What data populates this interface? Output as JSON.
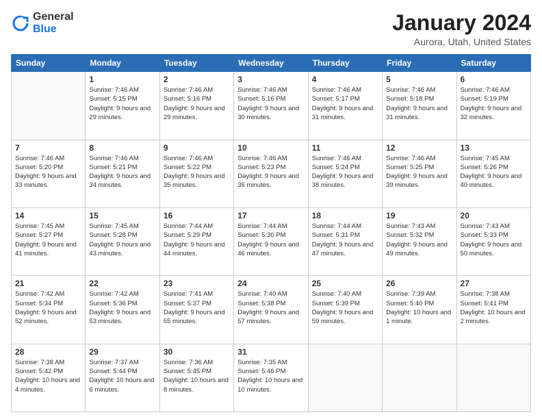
{
  "logo": {
    "general": "General",
    "blue": "Blue"
  },
  "header": {
    "month": "January 2024",
    "location": "Aurora, Utah, United States"
  },
  "weekdays": [
    "Sunday",
    "Monday",
    "Tuesday",
    "Wednesday",
    "Thursday",
    "Friday",
    "Saturday"
  ],
  "weeks": [
    [
      {
        "day": "",
        "sunrise": "",
        "sunset": "",
        "daylight": ""
      },
      {
        "day": "1",
        "sunrise": "Sunrise: 7:46 AM",
        "sunset": "Sunset: 5:15 PM",
        "daylight": "Daylight: 9 hours and 29 minutes."
      },
      {
        "day": "2",
        "sunrise": "Sunrise: 7:46 AM",
        "sunset": "Sunset: 5:16 PM",
        "daylight": "Daylight: 9 hours and 29 minutes."
      },
      {
        "day": "3",
        "sunrise": "Sunrise: 7:46 AM",
        "sunset": "Sunset: 5:16 PM",
        "daylight": "Daylight: 9 hours and 30 minutes."
      },
      {
        "day": "4",
        "sunrise": "Sunrise: 7:46 AM",
        "sunset": "Sunset: 5:17 PM",
        "daylight": "Daylight: 9 hours and 31 minutes."
      },
      {
        "day": "5",
        "sunrise": "Sunrise: 7:46 AM",
        "sunset": "Sunset: 5:18 PM",
        "daylight": "Daylight: 9 hours and 31 minutes."
      },
      {
        "day": "6",
        "sunrise": "Sunrise: 7:46 AM",
        "sunset": "Sunset: 5:19 PM",
        "daylight": "Daylight: 9 hours and 32 minutes."
      }
    ],
    [
      {
        "day": "7",
        "sunrise": "Sunrise: 7:46 AM",
        "sunset": "Sunset: 5:20 PM",
        "daylight": "Daylight: 9 hours and 33 minutes."
      },
      {
        "day": "8",
        "sunrise": "Sunrise: 7:46 AM",
        "sunset": "Sunset: 5:21 PM",
        "daylight": "Daylight: 9 hours and 34 minutes."
      },
      {
        "day": "9",
        "sunrise": "Sunrise: 7:46 AM",
        "sunset": "Sunset: 5:22 PM",
        "daylight": "Daylight: 9 hours and 35 minutes."
      },
      {
        "day": "10",
        "sunrise": "Sunrise: 7:46 AM",
        "sunset": "Sunset: 5:23 PM",
        "daylight": "Daylight: 9 hours and 36 minutes."
      },
      {
        "day": "11",
        "sunrise": "Sunrise: 7:46 AM",
        "sunset": "Sunset: 5:24 PM",
        "daylight": "Daylight: 9 hours and 38 minutes."
      },
      {
        "day": "12",
        "sunrise": "Sunrise: 7:46 AM",
        "sunset": "Sunset: 5:25 PM",
        "daylight": "Daylight: 9 hours and 39 minutes."
      },
      {
        "day": "13",
        "sunrise": "Sunrise: 7:45 AM",
        "sunset": "Sunset: 5:26 PM",
        "daylight": "Daylight: 9 hours and 40 minutes."
      }
    ],
    [
      {
        "day": "14",
        "sunrise": "Sunrise: 7:45 AM",
        "sunset": "Sunset: 5:27 PM",
        "daylight": "Daylight: 9 hours and 41 minutes."
      },
      {
        "day": "15",
        "sunrise": "Sunrise: 7:45 AM",
        "sunset": "Sunset: 5:28 PM",
        "daylight": "Daylight: 9 hours and 43 minutes."
      },
      {
        "day": "16",
        "sunrise": "Sunrise: 7:44 AM",
        "sunset": "Sunset: 5:29 PM",
        "daylight": "Daylight: 9 hours and 44 minutes."
      },
      {
        "day": "17",
        "sunrise": "Sunrise: 7:44 AM",
        "sunset": "Sunset: 5:30 PM",
        "daylight": "Daylight: 9 hours and 46 minutes."
      },
      {
        "day": "18",
        "sunrise": "Sunrise: 7:44 AM",
        "sunset": "Sunset: 5:31 PM",
        "daylight": "Daylight: 9 hours and 47 minutes."
      },
      {
        "day": "19",
        "sunrise": "Sunrise: 7:43 AM",
        "sunset": "Sunset: 5:32 PM",
        "daylight": "Daylight: 9 hours and 49 minutes."
      },
      {
        "day": "20",
        "sunrise": "Sunrise: 7:43 AM",
        "sunset": "Sunset: 5:33 PM",
        "daylight": "Daylight: 9 hours and 50 minutes."
      }
    ],
    [
      {
        "day": "21",
        "sunrise": "Sunrise: 7:42 AM",
        "sunset": "Sunset: 5:34 PM",
        "daylight": "Daylight: 9 hours and 52 minutes."
      },
      {
        "day": "22",
        "sunrise": "Sunrise: 7:42 AM",
        "sunset": "Sunset: 5:36 PM",
        "daylight": "Daylight: 9 hours and 53 minutes."
      },
      {
        "day": "23",
        "sunrise": "Sunrise: 7:41 AM",
        "sunset": "Sunset: 5:37 PM",
        "daylight": "Daylight: 9 hours and 55 minutes."
      },
      {
        "day": "24",
        "sunrise": "Sunrise: 7:40 AM",
        "sunset": "Sunset: 5:38 PM",
        "daylight": "Daylight: 9 hours and 57 minutes."
      },
      {
        "day": "25",
        "sunrise": "Sunrise: 7:40 AM",
        "sunset": "Sunset: 5:39 PM",
        "daylight": "Daylight: 9 hours and 59 minutes."
      },
      {
        "day": "26",
        "sunrise": "Sunrise: 7:39 AM",
        "sunset": "Sunset: 5:40 PM",
        "daylight": "Daylight: 10 hours and 1 minute."
      },
      {
        "day": "27",
        "sunrise": "Sunrise: 7:38 AM",
        "sunset": "Sunset: 5:41 PM",
        "daylight": "Daylight: 10 hours and 2 minutes."
      }
    ],
    [
      {
        "day": "28",
        "sunrise": "Sunrise: 7:38 AM",
        "sunset": "Sunset: 5:42 PM",
        "daylight": "Daylight: 10 hours and 4 minutes."
      },
      {
        "day": "29",
        "sunrise": "Sunrise: 7:37 AM",
        "sunset": "Sunset: 5:44 PM",
        "daylight": "Daylight: 10 hours and 6 minutes."
      },
      {
        "day": "30",
        "sunrise": "Sunrise: 7:36 AM",
        "sunset": "Sunset: 5:45 PM",
        "daylight": "Daylight: 10 hours and 8 minutes."
      },
      {
        "day": "31",
        "sunrise": "Sunrise: 7:35 AM",
        "sunset": "Sunset: 5:46 PM",
        "daylight": "Daylight: 10 hours and 10 minutes."
      },
      {
        "day": "",
        "sunrise": "",
        "sunset": "",
        "daylight": ""
      },
      {
        "day": "",
        "sunrise": "",
        "sunset": "",
        "daylight": ""
      },
      {
        "day": "",
        "sunrise": "",
        "sunset": "",
        "daylight": ""
      }
    ]
  ]
}
